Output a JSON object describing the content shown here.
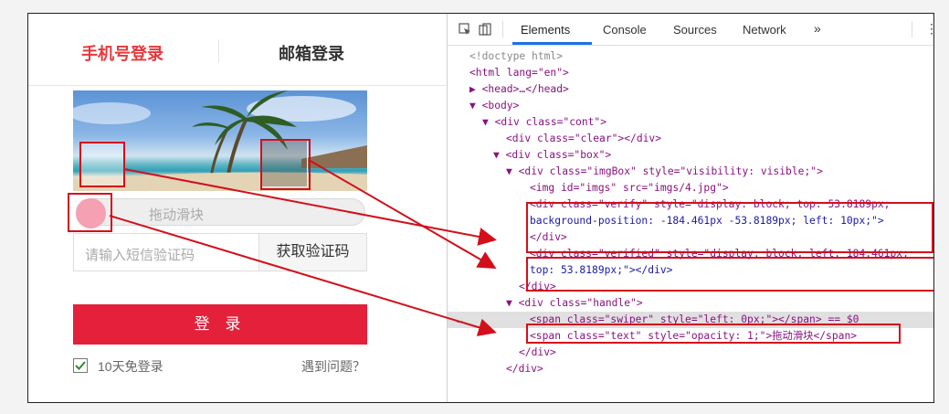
{
  "login": {
    "tabs": {
      "phone": "手机号登录",
      "email": "邮箱登录"
    },
    "slider_text": "拖动滑块",
    "sms_placeholder": "请输入短信验证码",
    "get_code": "获取验证码",
    "login_button": "登 录",
    "remember": "10天免登录",
    "help": "遇到问题？",
    "accent": "#e4203b"
  },
  "devtools": {
    "tabs": [
      "Elements",
      "Console",
      "Sources",
      "Network"
    ],
    "more": "»",
    "lines": [
      {
        "t": "<!doctype html>"
      },
      {
        "t": "<html lang=\"en\">"
      },
      {
        "t": "▶ <head>…</head>"
      },
      {
        "t": "▼ <body>"
      },
      {
        "t": "▼ <div class=\"cont\">"
      },
      {
        "t": "<div class=\"clear\"></div>"
      },
      {
        "t": "▼ <div class=\"box\">"
      },
      {
        "t": "▼ <div class=\"imgBox\" style=\"visibility: visible;\">"
      },
      {
        "t": "<img id=\"imgs\" src=\"imgs/4.jpg\">"
      },
      {
        "t": "<div class=\"verify\" style=\"display: block; top: 53.8189px;"
      },
      {
        "t": "background-position: -184.461px -53.8189px; left: 10px;\">"
      },
      {
        "t": "</div>"
      },
      {
        "t": "<div class=\"verified\" style=\"display: block; left: 184.461px;"
      },
      {
        "t": "top: 53.8189px;\"></div>"
      },
      {
        "t": "</div>"
      },
      {
        "t": "▼ <div class=\"handle\">"
      },
      {
        "t": "<span class=\"swiper\" style=\"left: 0px;\"></span> == $0"
      },
      {
        "t": "<span class=\"text\" style=\"opacity: 1;\">拖动滑块</span>"
      },
      {
        "t": "</div>"
      },
      {
        "t": "</div>"
      }
    ]
  }
}
